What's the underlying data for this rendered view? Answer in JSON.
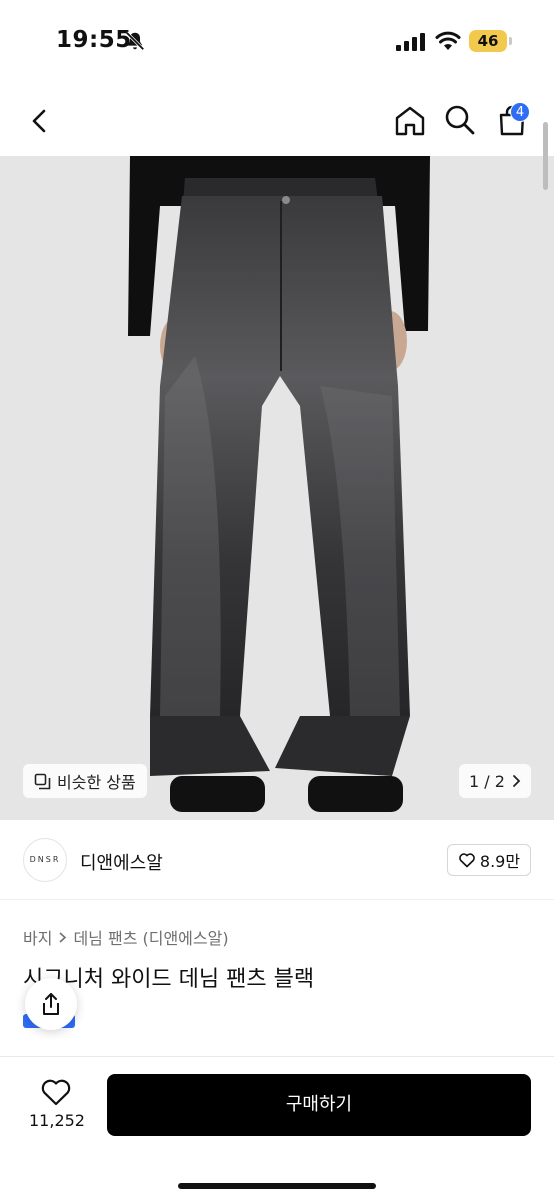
{
  "status_bar": {
    "time": "19:55",
    "battery": "46"
  },
  "nav": {
    "cart_count": "4"
  },
  "gallery": {
    "similar_label": "비슷한 상품",
    "pager": "1 / 2"
  },
  "brand": {
    "logo_text": "DNSR",
    "name": "디앤에스알",
    "likes": "8.9만"
  },
  "product": {
    "category_1": "바지",
    "category_2": "데님 팬츠 (디앤에스알)",
    "title": "시그니처 와이드 데님 팬츠 블랙"
  },
  "bottom_bar": {
    "wish_count": "11,252",
    "buy_label": "구매하기"
  },
  "colors": {
    "accent": "#2f6df6",
    "battery": "#f2c94c",
    "buy_button": "#000000"
  }
}
